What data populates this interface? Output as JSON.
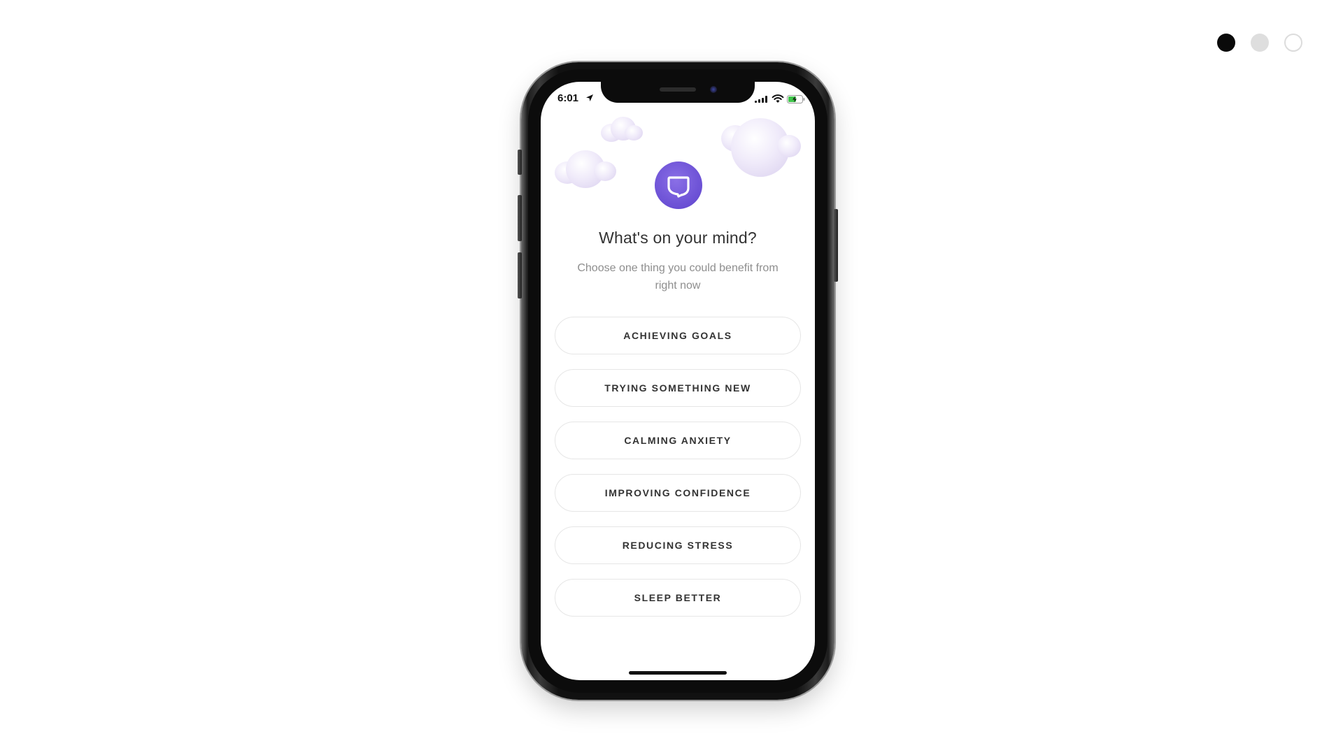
{
  "swatches": [
    {
      "name": "black",
      "color": "#0a0a0a",
      "selected": true
    },
    {
      "name": "gray",
      "color": "#dedede",
      "selected": false
    },
    {
      "name": "white",
      "color": "#ffffff",
      "selected": false
    }
  ],
  "status_bar": {
    "time": "6:01",
    "icons": [
      "location-arrow-icon",
      "cellular-signal-icon",
      "wifi-icon",
      "battery-charging-icon"
    ]
  },
  "app": {
    "icon": "speech-bubble-icon",
    "accent_color": "#6a4fd4",
    "title": "What's on your mind?",
    "subtitle": "Choose one thing you could benefit from right now",
    "options": [
      "ACHIEVING GOALS",
      "TRYING SOMETHING NEW",
      "CALMING ANXIETY",
      "IMPROVING CONFIDENCE",
      "REDUCING STRESS",
      "SLEEP BETTER"
    ]
  }
}
